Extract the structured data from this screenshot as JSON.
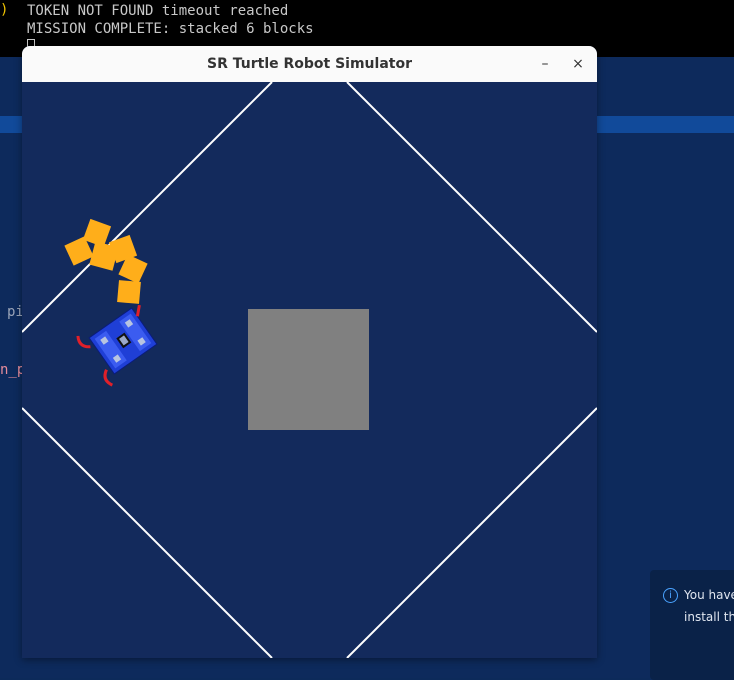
{
  "terminal": {
    "paren": ")",
    "lines": [
      "TOKEN NOT FOUND timeout reached",
      "MISSION COMPLETE: stacked 6 blocks"
    ]
  },
  "editor": {
    "fragment_1": "pi",
    "fragment_2": "n_p"
  },
  "notification": {
    "icon": "info-icon",
    "line_1": "You have",
    "line_2": "install th"
  },
  "window": {
    "title": "SR Turtle Robot Simulator",
    "minimize_symbol": "–",
    "close_symbol": "×"
  },
  "arena": {
    "token_count": 6,
    "colors": {
      "floor": "#132a5c",
      "lines": "#ffffff",
      "platform": "#808080",
      "token": "#ffae1a",
      "robot_body": "#1f3fd6"
    }
  }
}
